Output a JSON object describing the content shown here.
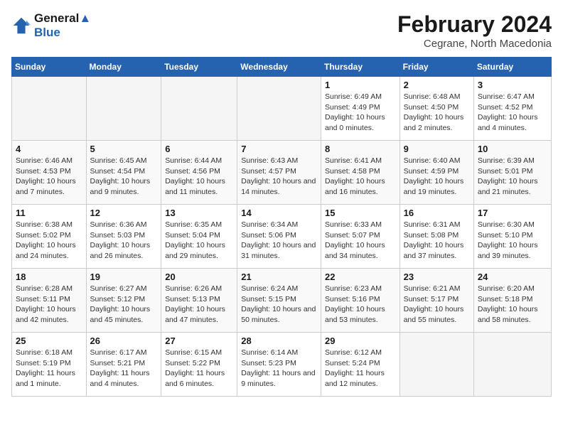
{
  "logo": {
    "line1": "General",
    "line2": "Blue"
  },
  "title": "February 2024",
  "subtitle": "Cegrane, North Macedonia",
  "days_of_week": [
    "Sunday",
    "Monday",
    "Tuesday",
    "Wednesday",
    "Thursday",
    "Friday",
    "Saturday"
  ],
  "weeks": [
    [
      {
        "day": "",
        "empty": true
      },
      {
        "day": "",
        "empty": true
      },
      {
        "day": "",
        "empty": true
      },
      {
        "day": "",
        "empty": true
      },
      {
        "day": "1",
        "sunrise": "Sunrise: 6:49 AM",
        "sunset": "Sunset: 4:49 PM",
        "daylight": "Daylight: 10 hours and 0 minutes."
      },
      {
        "day": "2",
        "sunrise": "Sunrise: 6:48 AM",
        "sunset": "Sunset: 4:50 PM",
        "daylight": "Daylight: 10 hours and 2 minutes."
      },
      {
        "day": "3",
        "sunrise": "Sunrise: 6:47 AM",
        "sunset": "Sunset: 4:52 PM",
        "daylight": "Daylight: 10 hours and 4 minutes."
      }
    ],
    [
      {
        "day": "4",
        "sunrise": "Sunrise: 6:46 AM",
        "sunset": "Sunset: 4:53 PM",
        "daylight": "Daylight: 10 hours and 7 minutes."
      },
      {
        "day": "5",
        "sunrise": "Sunrise: 6:45 AM",
        "sunset": "Sunset: 4:54 PM",
        "daylight": "Daylight: 10 hours and 9 minutes."
      },
      {
        "day": "6",
        "sunrise": "Sunrise: 6:44 AM",
        "sunset": "Sunset: 4:56 PM",
        "daylight": "Daylight: 10 hours and 11 minutes."
      },
      {
        "day": "7",
        "sunrise": "Sunrise: 6:43 AM",
        "sunset": "Sunset: 4:57 PM",
        "daylight": "Daylight: 10 hours and 14 minutes."
      },
      {
        "day": "8",
        "sunrise": "Sunrise: 6:41 AM",
        "sunset": "Sunset: 4:58 PM",
        "daylight": "Daylight: 10 hours and 16 minutes."
      },
      {
        "day": "9",
        "sunrise": "Sunrise: 6:40 AM",
        "sunset": "Sunset: 4:59 PM",
        "daylight": "Daylight: 10 hours and 19 minutes."
      },
      {
        "day": "10",
        "sunrise": "Sunrise: 6:39 AM",
        "sunset": "Sunset: 5:01 PM",
        "daylight": "Daylight: 10 hours and 21 minutes."
      }
    ],
    [
      {
        "day": "11",
        "sunrise": "Sunrise: 6:38 AM",
        "sunset": "Sunset: 5:02 PM",
        "daylight": "Daylight: 10 hours and 24 minutes."
      },
      {
        "day": "12",
        "sunrise": "Sunrise: 6:36 AM",
        "sunset": "Sunset: 5:03 PM",
        "daylight": "Daylight: 10 hours and 26 minutes."
      },
      {
        "day": "13",
        "sunrise": "Sunrise: 6:35 AM",
        "sunset": "Sunset: 5:04 PM",
        "daylight": "Daylight: 10 hours and 29 minutes."
      },
      {
        "day": "14",
        "sunrise": "Sunrise: 6:34 AM",
        "sunset": "Sunset: 5:06 PM",
        "daylight": "Daylight: 10 hours and 31 minutes."
      },
      {
        "day": "15",
        "sunrise": "Sunrise: 6:33 AM",
        "sunset": "Sunset: 5:07 PM",
        "daylight": "Daylight: 10 hours and 34 minutes."
      },
      {
        "day": "16",
        "sunrise": "Sunrise: 6:31 AM",
        "sunset": "Sunset: 5:08 PM",
        "daylight": "Daylight: 10 hours and 37 minutes."
      },
      {
        "day": "17",
        "sunrise": "Sunrise: 6:30 AM",
        "sunset": "Sunset: 5:10 PM",
        "daylight": "Daylight: 10 hours and 39 minutes."
      }
    ],
    [
      {
        "day": "18",
        "sunrise": "Sunrise: 6:28 AM",
        "sunset": "Sunset: 5:11 PM",
        "daylight": "Daylight: 10 hours and 42 minutes."
      },
      {
        "day": "19",
        "sunrise": "Sunrise: 6:27 AM",
        "sunset": "Sunset: 5:12 PM",
        "daylight": "Daylight: 10 hours and 45 minutes."
      },
      {
        "day": "20",
        "sunrise": "Sunrise: 6:26 AM",
        "sunset": "Sunset: 5:13 PM",
        "daylight": "Daylight: 10 hours and 47 minutes."
      },
      {
        "day": "21",
        "sunrise": "Sunrise: 6:24 AM",
        "sunset": "Sunset: 5:15 PM",
        "daylight": "Daylight: 10 hours and 50 minutes."
      },
      {
        "day": "22",
        "sunrise": "Sunrise: 6:23 AM",
        "sunset": "Sunset: 5:16 PM",
        "daylight": "Daylight: 10 hours and 53 minutes."
      },
      {
        "day": "23",
        "sunrise": "Sunrise: 6:21 AM",
        "sunset": "Sunset: 5:17 PM",
        "daylight": "Daylight: 10 hours and 55 minutes."
      },
      {
        "day": "24",
        "sunrise": "Sunrise: 6:20 AM",
        "sunset": "Sunset: 5:18 PM",
        "daylight": "Daylight: 10 hours and 58 minutes."
      }
    ],
    [
      {
        "day": "25",
        "sunrise": "Sunrise: 6:18 AM",
        "sunset": "Sunset: 5:19 PM",
        "daylight": "Daylight: 11 hours and 1 minute."
      },
      {
        "day": "26",
        "sunrise": "Sunrise: 6:17 AM",
        "sunset": "Sunset: 5:21 PM",
        "daylight": "Daylight: 11 hours and 4 minutes."
      },
      {
        "day": "27",
        "sunrise": "Sunrise: 6:15 AM",
        "sunset": "Sunset: 5:22 PM",
        "daylight": "Daylight: 11 hours and 6 minutes."
      },
      {
        "day": "28",
        "sunrise": "Sunrise: 6:14 AM",
        "sunset": "Sunset: 5:23 PM",
        "daylight": "Daylight: 11 hours and 9 minutes."
      },
      {
        "day": "29",
        "sunrise": "Sunrise: 6:12 AM",
        "sunset": "Sunset: 5:24 PM",
        "daylight": "Daylight: 11 hours and 12 minutes."
      },
      {
        "day": "",
        "empty": true
      },
      {
        "day": "",
        "empty": true
      }
    ]
  ]
}
